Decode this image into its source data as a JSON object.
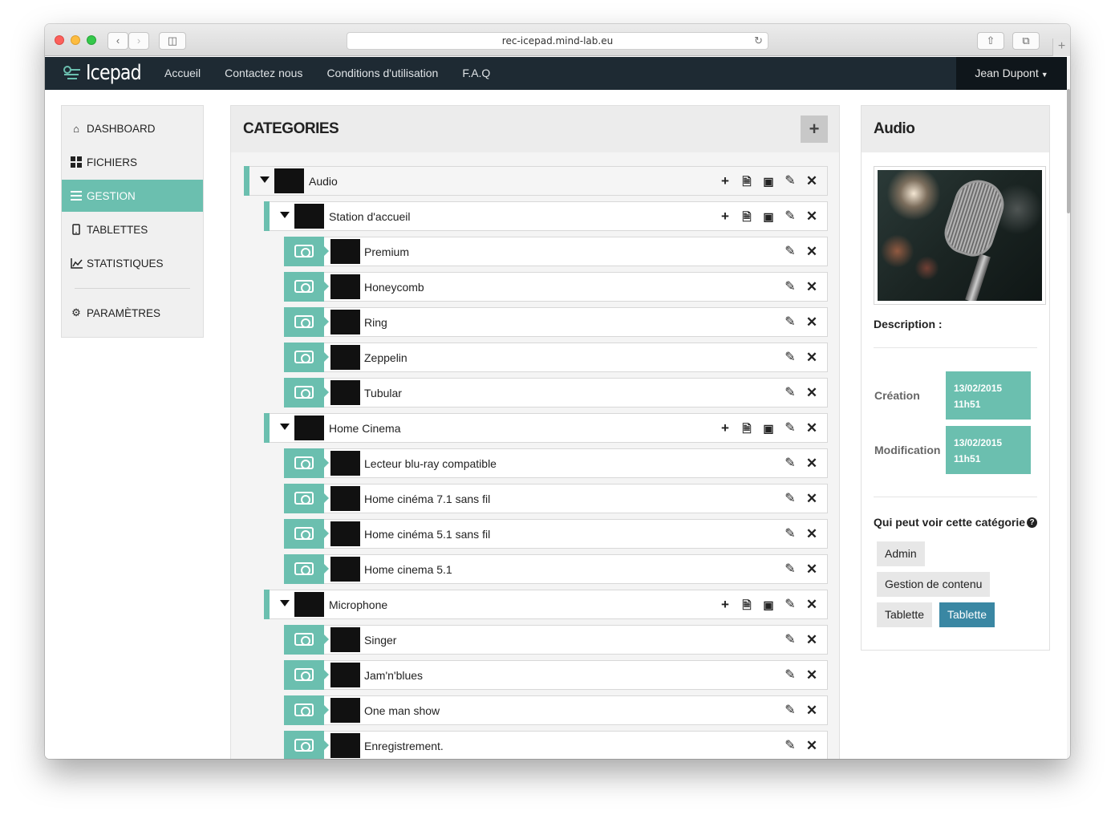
{
  "browser": {
    "url": "rec-icepad.mind-lab.eu"
  },
  "navbar": {
    "brand": "Icepad",
    "links": [
      "Accueil",
      "Contactez nous",
      "Conditions d'utilisation",
      "F.A.Q"
    ],
    "user": "Jean Dupont"
  },
  "sidebar": {
    "items": [
      {
        "label": "DASHBOARD",
        "icon": "home-icon"
      },
      {
        "label": "FICHIERS",
        "icon": "grid-icon"
      },
      {
        "label": "GESTION",
        "icon": "list-icon",
        "active": true
      },
      {
        "label": "TABLETTES",
        "icon": "tablet-icon"
      },
      {
        "label": "STATISTIQUES",
        "icon": "chart-icon"
      },
      {
        "label": "PARAMÈTRES",
        "icon": "gear-icon"
      }
    ]
  },
  "categories": {
    "title": "CATEGORIES",
    "rows": [
      {
        "label": "Audio",
        "level": 0,
        "type": "parent"
      },
      {
        "label": "Station d'accueil",
        "level": 1,
        "type": "parent"
      },
      {
        "label": "Premium",
        "level": 2,
        "type": "leaf"
      },
      {
        "label": "Honeycomb",
        "level": 2,
        "type": "leaf"
      },
      {
        "label": "Ring",
        "level": 2,
        "type": "leaf"
      },
      {
        "label": "Zeppelin",
        "level": 2,
        "type": "leaf"
      },
      {
        "label": "Tubular",
        "level": 2,
        "type": "leaf"
      },
      {
        "label": "Home Cinema",
        "level": 1,
        "type": "parent"
      },
      {
        "label": "Lecteur blu-ray compatible",
        "level": 2,
        "type": "leaf"
      },
      {
        "label": "Home cinéma 7.1 sans fil",
        "level": 2,
        "type": "leaf"
      },
      {
        "label": "Home cinéma 5.1 sans fil",
        "level": 2,
        "type": "leaf"
      },
      {
        "label": "Home cinema 5.1",
        "level": 2,
        "type": "leaf"
      },
      {
        "label": "Microphone",
        "level": 1,
        "type": "parent"
      },
      {
        "label": "Singer",
        "level": 2,
        "type": "leaf"
      },
      {
        "label": "Jam'n'blues",
        "level": 2,
        "type": "leaf"
      },
      {
        "label": "One man show",
        "level": 2,
        "type": "leaf"
      },
      {
        "label": "Enregistrement.",
        "level": 2,
        "type": "leaf"
      }
    ]
  },
  "detail": {
    "title": "Audio",
    "description_label": "Description :",
    "creation_label": "Création",
    "creation_date": "13/02/2015",
    "creation_time": "11h51",
    "modification_label": "Modification",
    "modification_date": "13/02/2015",
    "modification_time": "11h51",
    "visibility_label": "Qui peut voir cette catégorie",
    "help": "?",
    "roles": [
      "Admin",
      "Gestion de contenu",
      "Tablette",
      "Tablette"
    ],
    "accent_color": "#6bbfaf",
    "selected_role_color": "#3a87a3"
  }
}
